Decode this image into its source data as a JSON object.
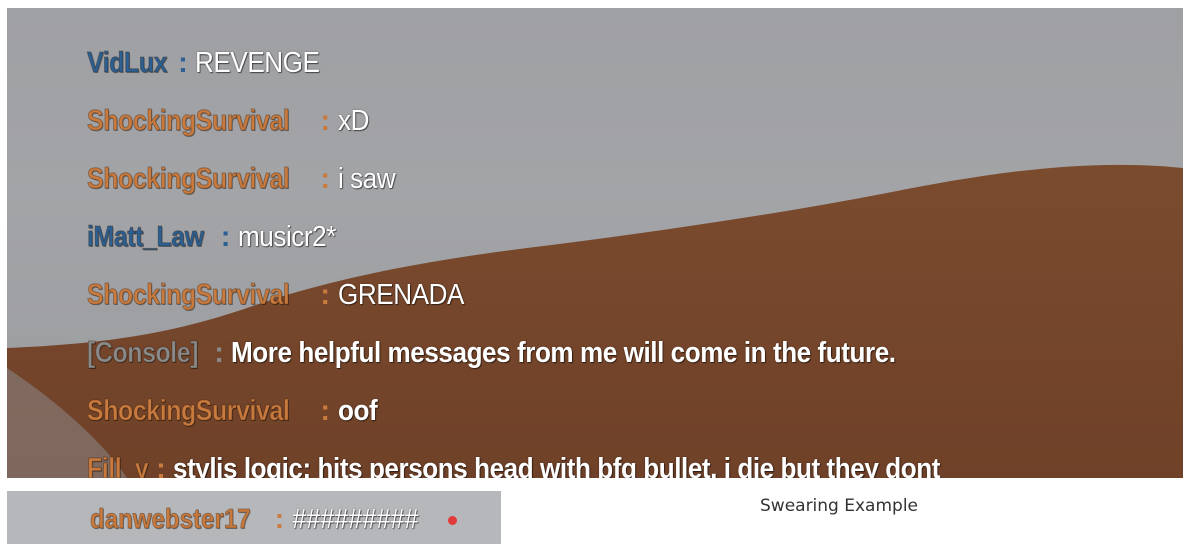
{
  "chat": {
    "lines": [
      {
        "name": "VidLux",
        "sep": ":",
        "message": "REVENGE",
        "color": "blue"
      },
      {
        "name": "ShockingSurvival",
        "sep": ":",
        "message": "xD",
        "color": "orange"
      },
      {
        "name": "ShockingSurvival",
        "sep": ":",
        "message": "i saw",
        "color": "orange"
      },
      {
        "name": "iMatt_Law",
        "sep": ":",
        "message": "musicr2*",
        "color": "blue"
      },
      {
        "name": "ShockingSurvival",
        "sep": ":",
        "message": "GRENADA",
        "color": "orange"
      },
      {
        "name": "[Console]",
        "sep": ":",
        "message": "More helpful messages from me will come in the future.",
        "color": "gray"
      },
      {
        "name": "ShockingSurvival",
        "sep": ":",
        "message": "oof",
        "color": "orange"
      },
      {
        "name": "Fill_y",
        "sep": ":",
        "message": "stylis logic: hits persons head with bfg bullet, i die but they dont",
        "color": "orange"
      }
    ]
  },
  "swear_example": {
    "name": "danwebster17",
    "sep": ":",
    "message": "#########",
    "caption": "Swearing Example"
  },
  "colors": {
    "orange_name": "#c97a3e",
    "blue_name": "#2c5f92",
    "console_name": "#8a8a8a",
    "background_gray": "#a0a1a4",
    "dirt_brown": "#7a4a2e"
  }
}
